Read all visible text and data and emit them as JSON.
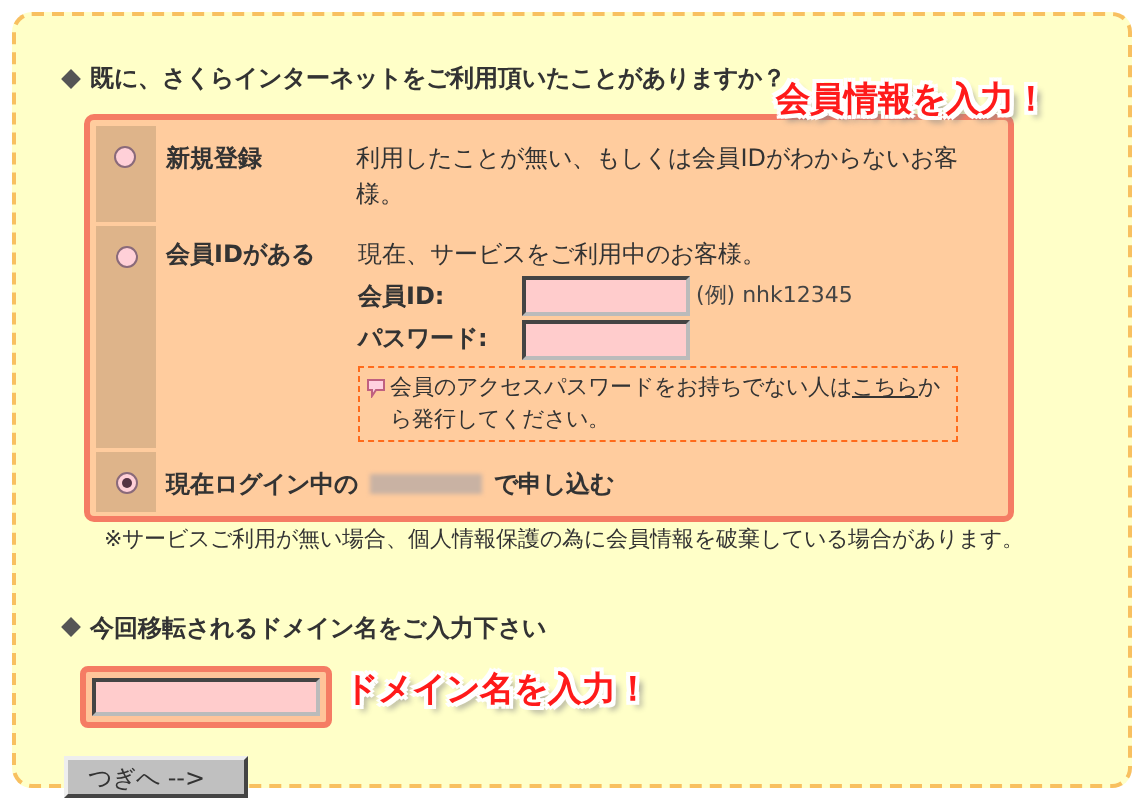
{
  "question": {
    "text": "既に、さくらインターネットをご利用頂いたことがありますか？",
    "callout": "会員情報を入力！"
  },
  "options": [
    {
      "kind": "new",
      "selected": false,
      "label": "新規登録",
      "description": "利用したことが無い、もしくは会員IDがわからないお客様。"
    },
    {
      "kind": "member",
      "selected": false,
      "label": "会員IDがある",
      "description": "現在、サービスをご利用中のお客様。",
      "id_label": "会員ID:",
      "id_example": "(例) nhk12345",
      "password_label": "パスワード:",
      "note_before": "会員のアクセスパスワードをお持ちでない人は",
      "note_link": "こちら",
      "note_after": "から発行してください。"
    },
    {
      "kind": "logged_in",
      "selected": true,
      "label_before": "現在ログイン中の",
      "label_after": "で申し込む"
    }
  ],
  "notice": "※サービスご利用が無い場合、個人情報保護の為に会員情報を破棄している場合があります。",
  "domain": {
    "heading": "今回移転されるドメイン名をご入力下さい",
    "callout": "ドメイン名を入力！"
  },
  "next_button": "つぎへ -->"
}
